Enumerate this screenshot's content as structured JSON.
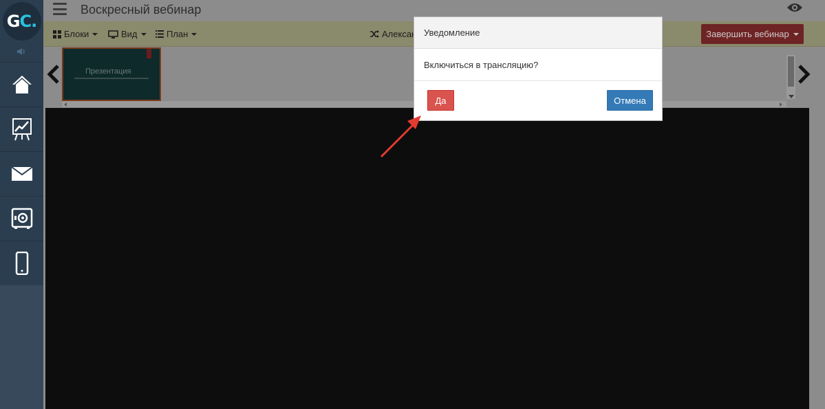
{
  "sidebar": {
    "logo": {
      "g": "G",
      "c": "C",
      "dot": "."
    },
    "items": [
      {
        "icon": "home-icon"
      },
      {
        "icon": "chart-board-icon"
      },
      {
        "icon": "mail-icon"
      },
      {
        "icon": "safe-icon"
      },
      {
        "icon": "mobile-icon"
      }
    ]
  },
  "header": {
    "title": "Воскресный вебинар"
  },
  "toolbar": {
    "blocks_label": "Блоки",
    "view_label": "Вид",
    "plan_label": "План",
    "presenter_label": "Алексан",
    "finish_label": "Завершить вебинар"
  },
  "slides": {
    "thumb_title": "Презентация"
  },
  "modal": {
    "title": "Уведомление",
    "message": "Включиться в трансляцию?",
    "yes_label": "Да",
    "cancel_label": "Отмена"
  },
  "colors": {
    "yes_button": "#d9534f",
    "cancel_button": "#337ab7",
    "finish_button": "#6e2424",
    "annotation_arrow": "#e53a2f",
    "sidebar": "#2b3e50"
  }
}
